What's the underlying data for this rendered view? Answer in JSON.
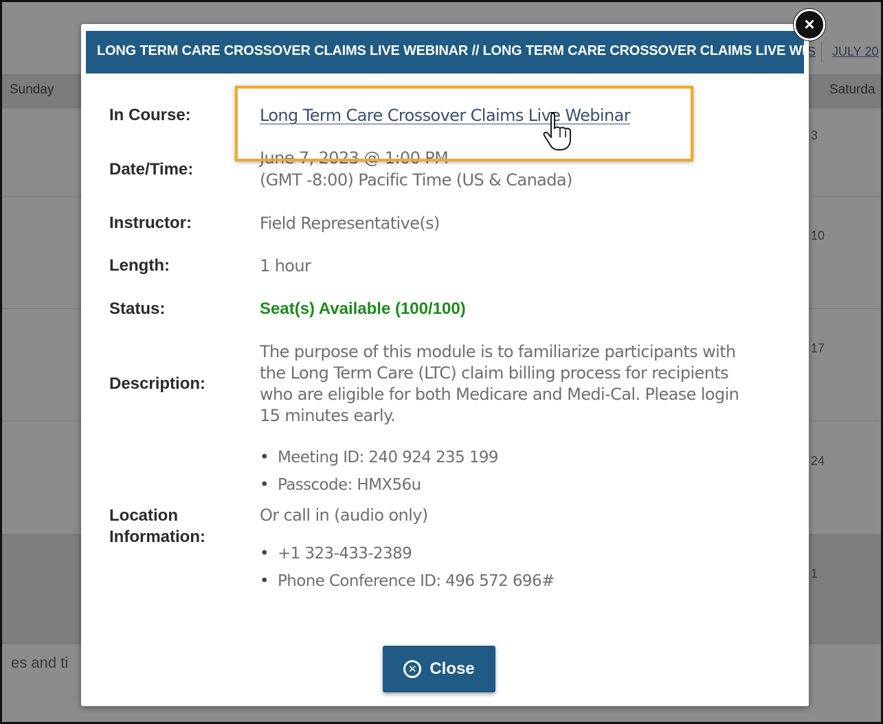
{
  "background": {
    "day_headers": {
      "sunday": "Sunday",
      "saturday": "Saturda"
    },
    "month_tabs": [
      "S",
      "JULY 20"
    ],
    "day_numbers": [
      "3",
      "10",
      "17",
      "24",
      "1"
    ],
    "bottom_text": "es and ti"
  },
  "modal": {
    "title": "LONG TERM CARE CROSSOVER CLAIMS LIVE WEBINAR // LONG TERM CARE CROSSOVER CLAIMS LIVE WEBINAR",
    "close_icon": "close-x-icon",
    "fields": {
      "course": {
        "label": "In Course:",
        "value": "Long Term Care Crossover Claims Live Webinar"
      },
      "datetime": {
        "label": "Date/Time:",
        "date": "June 7, 2023 @ 1:00 PM",
        "timezone": "(GMT -8:00) Pacific Time (US & Canada)"
      },
      "instructor": {
        "label": "Instructor:",
        "value": "Field Representative(s)"
      },
      "length": {
        "label": "Length:",
        "value": "1 hour"
      },
      "status": {
        "label": "Status:",
        "value": "Seat(s) Available (100/100)"
      },
      "description": {
        "label": "Description:",
        "value": "The purpose of this module is to familiarize participants with the Long Term Care (LTC) claim billing process for recipients who are eligible for both Medicare and Medi-Cal. Please login 15 minutes early."
      },
      "location": {
        "label": "Location Information:",
        "bullets_top": [
          "Meeting ID: 240 924 235 199",
          "Passcode: HMX56u"
        ],
        "call_in": "Or call in (audio only)",
        "bullets_bottom": [
          "+1 323-433-2389",
          "Phone Conference ID: 496 572 696#"
        ]
      }
    },
    "close_button": {
      "label": "Close",
      "icon": "close-circle-icon"
    }
  },
  "colors": {
    "header_blue": "#1f5b84",
    "status_green": "#1e8a1e",
    "highlight_orange": "#f0a928"
  }
}
